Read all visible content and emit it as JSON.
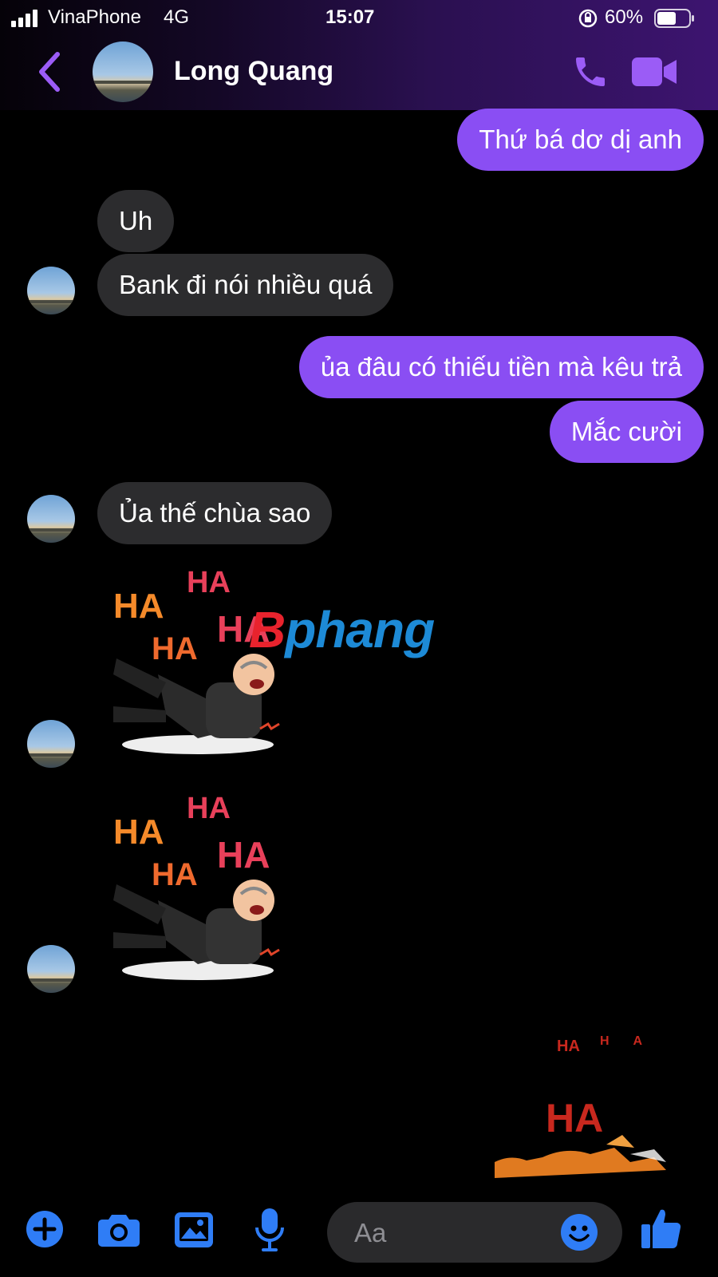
{
  "status_bar": {
    "carrier": "VinaPhone",
    "network": "4G",
    "time": "15:07",
    "battery": "60%",
    "battery_level": 0.6
  },
  "header": {
    "contact_name": "Long Quang",
    "back_icon": "chevron-left-icon",
    "call_icon": "phone-icon",
    "video_icon": "video-camera-icon"
  },
  "messages": [
    {
      "direction": "outgoing",
      "text": "Thứ bá dơ dị anh"
    },
    {
      "direction": "incoming",
      "text": "Uh"
    },
    {
      "direction": "incoming",
      "text": "Bank đi nói nhiều quá"
    },
    {
      "direction": "outgoing",
      "text": "ủa đâu có thiếu tiền mà kêu trả"
    },
    {
      "direction": "outgoing",
      "text": "Mắc cười"
    },
    {
      "direction": "incoming",
      "text": "Ủa thế chùa sao"
    },
    {
      "direction": "incoming",
      "sticker": "laughing-man-sticker",
      "sticker_text": [
        "HA",
        "HA",
        "HA",
        "HA"
      ]
    },
    {
      "direction": "incoming",
      "sticker": "laughing-man-sticker",
      "sticker_text": [
        "HA",
        "HA",
        "HA",
        "HA"
      ]
    },
    {
      "direction": "outgoing",
      "sticker": "laughing-fox-sticker",
      "sticker_text": [
        "HA",
        "HA",
        "HA"
      ]
    }
  ],
  "watermark": {
    "prefix": "B",
    "rest": "phang"
  },
  "composer": {
    "placeholder": "Aa",
    "icons": [
      "plus-icon",
      "camera-icon",
      "image-icon",
      "microphone-icon",
      "emoji-icon",
      "thumbs-up-icon"
    ]
  },
  "colors": {
    "accent": "#8a4ef3",
    "outgoing_bubble": "#8a4ef3",
    "incoming_bubble": "#2c2c2e",
    "composer_icon": "#2f7df6",
    "header_icon": "#9b5cf6"
  }
}
